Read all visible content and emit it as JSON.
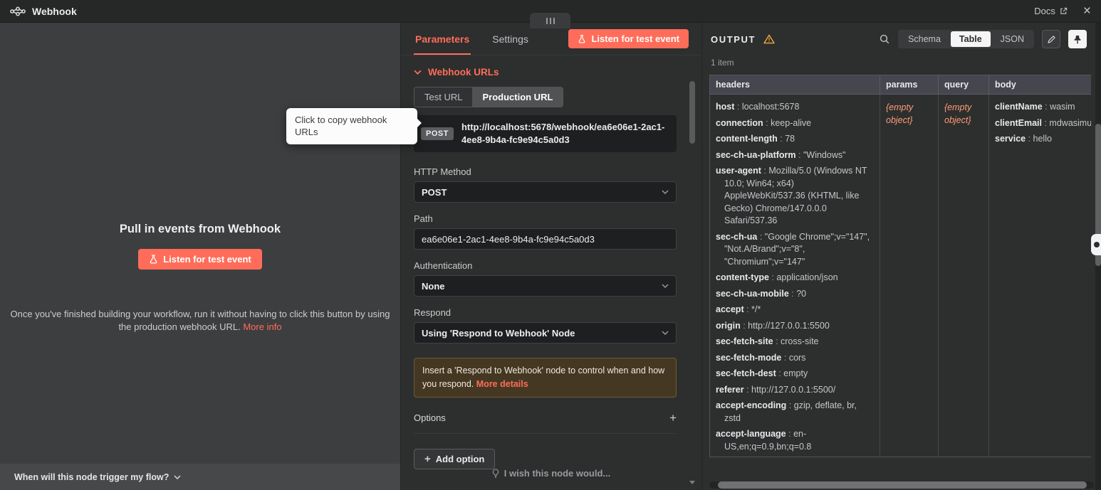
{
  "topbar": {
    "title": "Webhook",
    "docs_label": "Docs"
  },
  "left_panel": {
    "heading": "Pull in events from Webhook",
    "listen_button_label": "Listen for test event",
    "hint_text": "Once you've finished building your workflow, run it without having to click this button by using the production webhook URL.",
    "hint_link": "More info",
    "footer_label": "When will this node trigger my flow?",
    "tooltip_text": "Click to copy webhook URLs"
  },
  "params_panel": {
    "tabs": [
      {
        "label": "Parameters",
        "active": true
      },
      {
        "label": "Settings",
        "active": false
      }
    ],
    "listen_button_label": "Listen for test event",
    "webhook_urls": {
      "section_label": "Webhook URLs",
      "url_tabs": [
        {
          "label": "Test URL",
          "active": false
        },
        {
          "label": "Production URL",
          "active": true
        }
      ],
      "method_badge": "POST",
      "url": "http://localhost:5678/webhook/ea6e06e1-2ac1-4ee8-9b4a-fc9e94c5a0d3"
    },
    "fields": {
      "http_method": {
        "label": "HTTP Method",
        "value": "POST"
      },
      "path": {
        "label": "Path",
        "value": "ea6e06e1-2ac1-4ee8-9b4a-fc9e94c5a0d3"
      },
      "authentication": {
        "label": "Authentication",
        "value": "None"
      },
      "respond": {
        "label": "Respond",
        "value": "Using 'Respond to Webhook' Node"
      }
    },
    "notice": {
      "text": "Insert a 'Respond to Webhook' node to control when and how you respond.",
      "link_label": "More details"
    },
    "options_label": "Options",
    "add_option_label": "Add option",
    "wish_label": "I wish this node would..."
  },
  "output_panel": {
    "title": "OUTPUT",
    "items_count": "1 item",
    "views": [
      {
        "label": "Schema",
        "active": false
      },
      {
        "label": "Table",
        "active": true
      },
      {
        "label": "JSON",
        "active": false
      }
    ],
    "table": {
      "columns": [
        "headers",
        "params",
        "query",
        "body"
      ],
      "headers_entries": [
        {
          "key": "host",
          "value": "localhost:5678"
        },
        {
          "key": "connection",
          "value": "keep-alive"
        },
        {
          "key": "content-length",
          "value": "78"
        },
        {
          "key": "sec-ch-ua-platform",
          "value": "\"Windows\""
        },
        {
          "key": "user-agent",
          "value": "Mozilla/5.0 (Windows NT 10.0; Win64; x64) AppleWebKit/537.36 (KHTML, like Gecko) Chrome/147.0.0.0 Safari/537.36"
        },
        {
          "key": "sec-ch-ua",
          "value": "\"Google Chrome\";v=\"147\", \"Not.A/Brand\";v=\"8\", \"Chromium\";v=\"147\""
        },
        {
          "key": "content-type",
          "value": "application/json"
        },
        {
          "key": "sec-ch-ua-mobile",
          "value": "?0"
        },
        {
          "key": "accept",
          "value": "*/*"
        },
        {
          "key": "origin",
          "value": "http://127.0.0.1:5500"
        },
        {
          "key": "sec-fetch-site",
          "value": "cross-site"
        },
        {
          "key": "sec-fetch-mode",
          "value": "cors"
        },
        {
          "key": "sec-fetch-dest",
          "value": "empty"
        },
        {
          "key": "referer",
          "value": "http://127.0.0.1:5500/"
        },
        {
          "key": "accept-encoding",
          "value": "gzip, deflate, br, zstd"
        },
        {
          "key": "accept-language",
          "value": "en-US,en;q=0.9,bn;q=0.8"
        }
      ],
      "params_value": "{empty object}",
      "query_value": "{empty object}",
      "body_entries": [
        {
          "key": "clientName",
          "value": "wasim"
        },
        {
          "key": "clientEmail",
          "value": "mdwasimu"
        },
        {
          "key": "service",
          "value": "hello"
        }
      ]
    }
  }
}
